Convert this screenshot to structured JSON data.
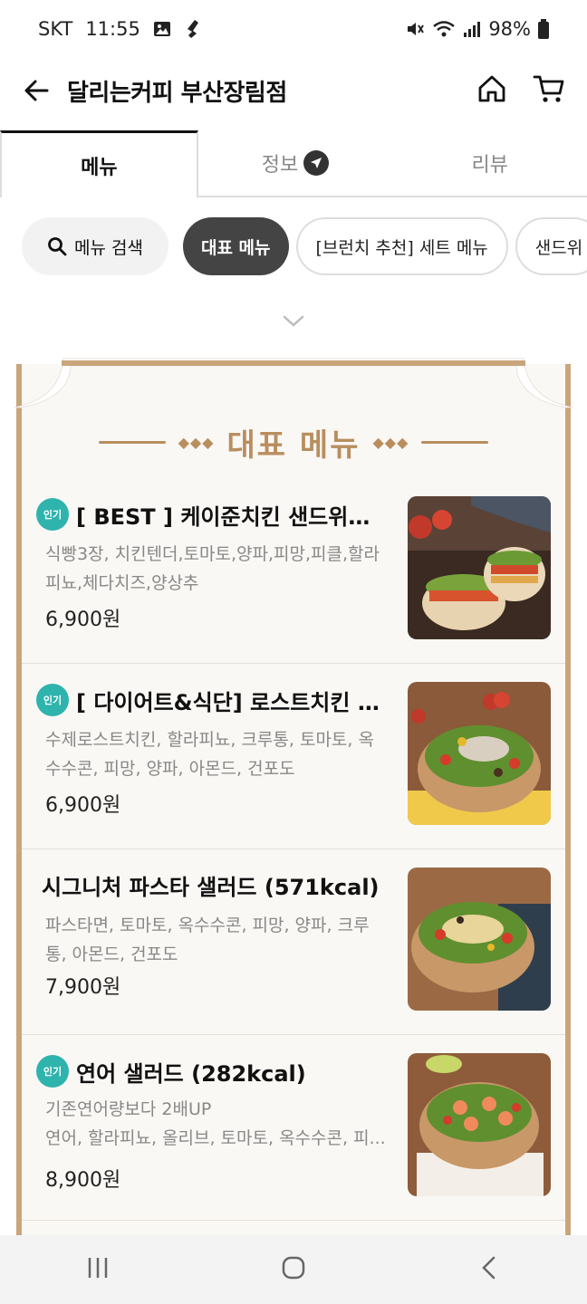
{
  "status": {
    "carrier": "SKT",
    "time": "11:55",
    "battery": "98%"
  },
  "appbar": {
    "title": "달리는커피 부산장림점"
  },
  "tabs": [
    {
      "label": "메뉴"
    },
    {
      "label": "정보"
    },
    {
      "label": "리뷰"
    }
  ],
  "chips": {
    "search": "메뉴 검색",
    "items": [
      "대표 메뉴",
      "[브런치 추천] 세트 메뉴",
      "샌드위"
    ]
  },
  "board": {
    "title": "대표 메뉴"
  },
  "hot_label": "인기",
  "menu_items": [
    {
      "name": "[ BEST ] 케이준치킨 샌드위치 (...",
      "desc": "식빵3장, 치킨텐더,토마토,양파,피망,피클,할라피뇨,체다치즈,양상추",
      "price": "6,900원",
      "hot": true
    },
    {
      "name": "[ 다이어트&식단] 로스트치킨 샐...",
      "desc": "수제로스트치킨, 할라피뇨, 크루통, 토마토, 옥수수콘, 피망, 양파, 아몬드, 건포도",
      "price": "6,900원",
      "hot": true
    },
    {
      "name": "시그니처 파스타 샐러드 (571kcal)",
      "desc": "파스타면, 토마토, 옥수수콘, 피망, 양파, 크루통, 아몬드, 건포도",
      "price": "7,900원",
      "hot": false
    },
    {
      "name": "연어 샐러드 (282kcal)",
      "desc_line1": "기존연어량보다 2배UP",
      "desc_line2": "연어, 할라피뇨, 올리브, 토마토, 옥수수콘, 피...",
      "price": "8,900원",
      "hot": true
    }
  ],
  "colors": {
    "accent_gold": "#b98e5f",
    "hot_badge": "#2fb3ad",
    "chip_selected": "#444444"
  }
}
